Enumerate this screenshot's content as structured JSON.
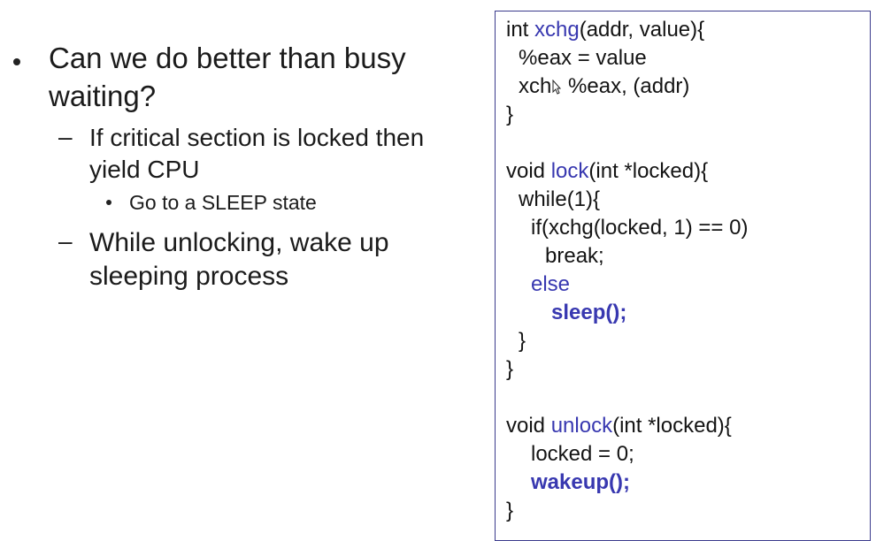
{
  "bullets": {
    "main": "Can we do better than busy waiting?",
    "sub1": "If critical section is locked then yield CPU",
    "sub1_item": "Go to a SLEEP state",
    "sub2": "While unlocking, wake up sleeping process",
    "dash": "–"
  },
  "code": {
    "xchg": {
      "l1_a": "int ",
      "l1_fn": "xchg",
      "l1_b": "(addr, value){",
      "l2": "%eax = value",
      "l3_a": "xch",
      "l3_b": " %eax, (addr)",
      "l4": "}"
    },
    "lock": {
      "l1_a": "void ",
      "l1_fn": "lock",
      "l1_b": "(int *locked){",
      "l2": "while(1){",
      "l3": "if(xchg(locked, 1) == 0)",
      "l4": "break;",
      "l5": "else",
      "l6": "sleep();",
      "l7": "}",
      "l8": "}"
    },
    "unlock": {
      "l1_a": "void ",
      "l1_fn": "unlock",
      "l1_b": "(int *locked){",
      "l2": "locked = 0;",
      "l3": "wakeup();",
      "l4": "}"
    }
  },
  "colors": {
    "keyword": "#3838b0",
    "text": "#141414",
    "border": "#3a3a8c"
  }
}
